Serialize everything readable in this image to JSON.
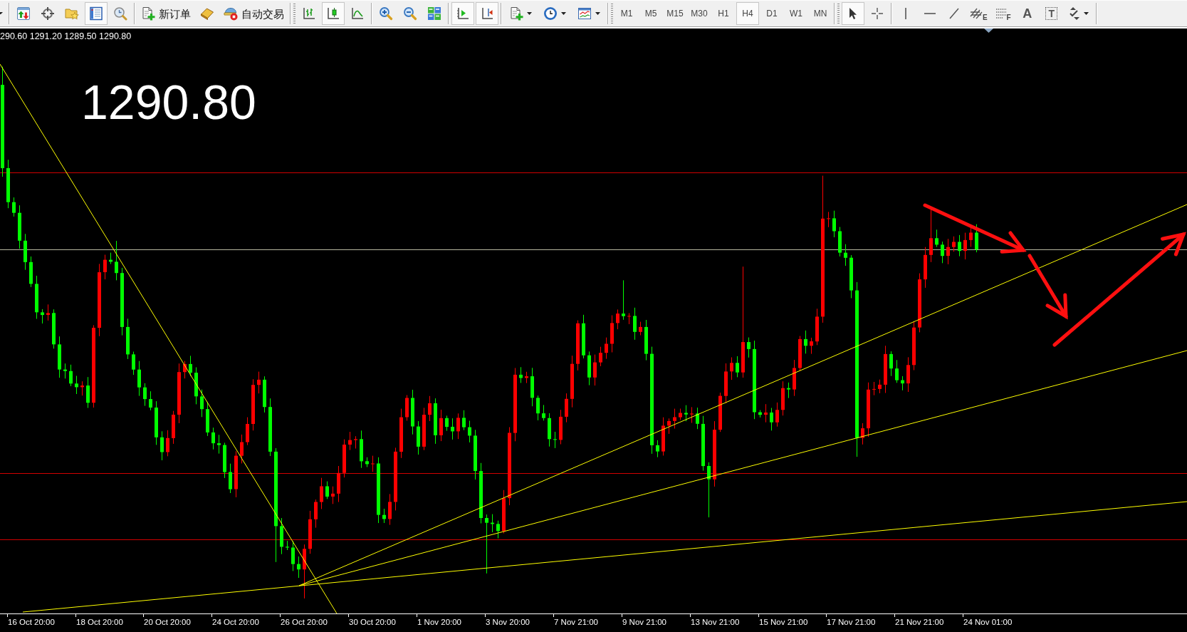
{
  "toolbar": {
    "general": [
      {
        "pressed": false
      },
      {
        "pressed": false
      },
      {
        "pressed": false
      },
      {
        "pressed": true
      },
      {
        "pressed": false
      },
      {
        "label": "新订单",
        "pressed": false
      },
      {
        "pressed": false
      },
      {
        "label": "自动交易",
        "pressed": false
      }
    ],
    "charts": [
      {
        "pressed": false
      },
      {
        "pressed": true
      },
      {
        "pressed": false
      },
      {
        "pressed": false
      },
      {
        "pressed": false
      },
      {
        "pressed": false
      },
      {
        "pressed": true
      },
      {
        "pressed": true
      },
      {
        "pressed": false
      },
      {
        "pressed": false
      },
      {
        "pressed": false
      }
    ],
    "periods": [
      {
        "label": "M1",
        "selected": false
      },
      {
        "label": "M5",
        "selected": false
      },
      {
        "label": "M15",
        "selected": false
      },
      {
        "label": "M30",
        "selected": false
      },
      {
        "label": "H1",
        "selected": false
      },
      {
        "label": "H4",
        "selected": true
      },
      {
        "label": "D1",
        "selected": false
      },
      {
        "label": "W1",
        "selected": false
      },
      {
        "label": "MN",
        "selected": false
      }
    ],
    "line_studies": [
      {
        "pressed": true
      },
      {
        "pressed": false
      },
      {
        "pressed": false
      },
      {
        "pressed": false
      },
      {
        "pressed": false
      },
      {
        "label": "E",
        "pressed": false
      },
      {
        "label": "F",
        "pressed": false
      },
      {
        "label": "A",
        "pressed": false
      },
      {
        "label": "T",
        "pressed": false
      },
      {
        "pressed": false
      }
    ]
  },
  "chart": {
    "ohlc": "290.60 1291.20 1289.50 1290.80",
    "price": "1290.80",
    "time_labels": [
      "16 Oct 20:00",
      "18 Oct 20:00",
      "20 Oct 20:00",
      "24 Oct 20:00",
      "26 Oct 20:00",
      "30 Oct 20:00",
      "1 Nov 20:00",
      "3 Nov 20:00",
      "7 Nov 21:00",
      "9 Nov 21:00",
      "13 Nov 21:00",
      "15 Nov 21:00",
      "17 Nov 21:00",
      "21 Nov 21:00",
      "24 Nov 01:00"
    ]
  }
}
